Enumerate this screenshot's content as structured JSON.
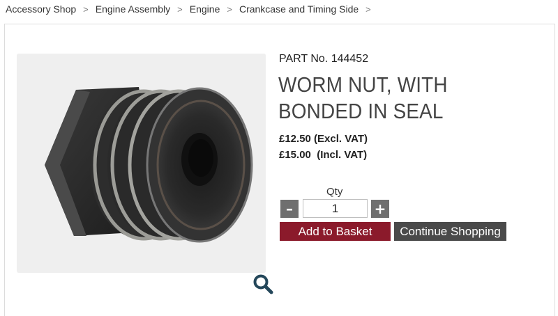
{
  "breadcrumb": {
    "items": [
      "Accessory Shop",
      "Engine Assembly",
      "Engine",
      "Crankcase and Timing Side"
    ],
    "separator": ">"
  },
  "product": {
    "part_no": "PART No. 144452",
    "title": "WORM NUT, WITH BONDED IN SEAL",
    "price_excl": "£12.50 (Excl. VAT)",
    "price_incl": "£15.00  (Incl. VAT)",
    "image": "worm-nut-photo"
  },
  "quantity": {
    "label": "Qty",
    "value": "1",
    "minus": "–",
    "plus": "+"
  },
  "actions": {
    "add_to_basket": "Add to Basket",
    "continue_shopping": "Continue Shopping"
  },
  "colors": {
    "basket_button": "#8b1a2b",
    "continue_button": "#4a4a4a",
    "qty_buttons": "#6f6f6f",
    "zoom_icon": "#24475a"
  },
  "icons": {
    "zoom": "magnifier-icon"
  }
}
